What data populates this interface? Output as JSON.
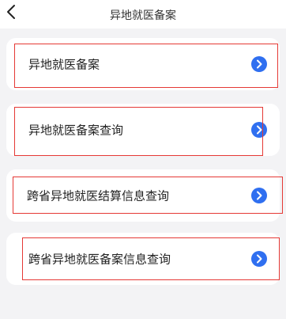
{
  "header": {
    "title": "异地就医备案",
    "back_icon": "chevron-left-icon"
  },
  "menu": {
    "items": [
      {
        "label": "异地就医备案",
        "icon": "chevron-right-circle-icon"
      },
      {
        "label": "异地就医备案查询",
        "icon": "chevron-right-circle-icon"
      },
      {
        "label": "跨省异地就医结算信息查询",
        "icon": "chevron-right-circle-icon"
      },
      {
        "label": "跨省异地就医备案信息查询",
        "icon": "chevron-right-circle-icon"
      }
    ]
  },
  "colors": {
    "background": "#f3f3f5",
    "card": "#ffffff",
    "accent_blue": "#2f6ff0",
    "highlight_red": "#e53935"
  }
}
